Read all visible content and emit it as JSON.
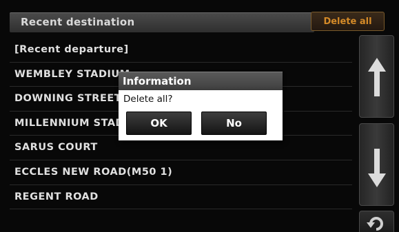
{
  "header": {
    "title": "Recent destination",
    "delete_all_label": "Delete all"
  },
  "list": {
    "items": [
      "[Recent departure]",
      "WEMBLEY STADIUM",
      "DOWNING STREET",
      "MILLENNIUM STADIUM",
      "SARUS COURT",
      "ECCLES NEW ROAD(M50 1)",
      "REGENT ROAD"
    ]
  },
  "dialog": {
    "title": "Information",
    "message": "Delete all?",
    "ok_label": "OK",
    "no_label": "No"
  },
  "icons": {
    "scroll_up": "arrow-up-icon",
    "scroll_down": "arrow-down-icon",
    "back": "back-icon"
  },
  "colors": {
    "accent": "#d48a28",
    "background": "#080808",
    "dialog_bg": "#ffffff"
  }
}
